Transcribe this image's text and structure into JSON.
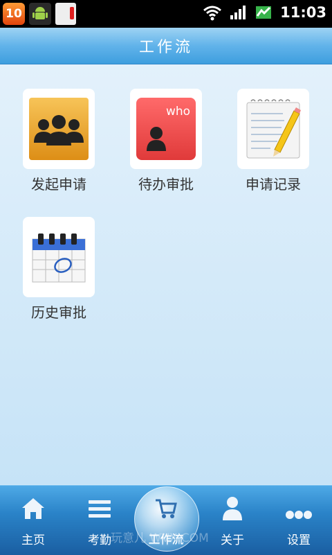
{
  "status_bar": {
    "notification_count": "10",
    "time": "11:03"
  },
  "header": {
    "title": "工作流"
  },
  "tiles": [
    {
      "label": "发起申请",
      "icon": "group-users-icon"
    },
    {
      "label": "待办审批",
      "icon": "who-pending-icon"
    },
    {
      "label": "申请记录",
      "icon": "notepad-pencil-icon"
    },
    {
      "label": "历史审批",
      "icon": "calendar-icon"
    }
  ],
  "bottom_nav": {
    "items": [
      {
        "label": "主页",
        "icon": "home-icon"
      },
      {
        "label": "考勤",
        "icon": "list-icon"
      },
      {
        "label": "工作流",
        "icon": "cart-icon"
      },
      {
        "label": "关于",
        "icon": "person-icon"
      },
      {
        "label": "设置",
        "icon": "more-dots-icon"
      }
    ],
    "active_index": 2
  },
  "watermark": "玩意儿 WVX.COM"
}
